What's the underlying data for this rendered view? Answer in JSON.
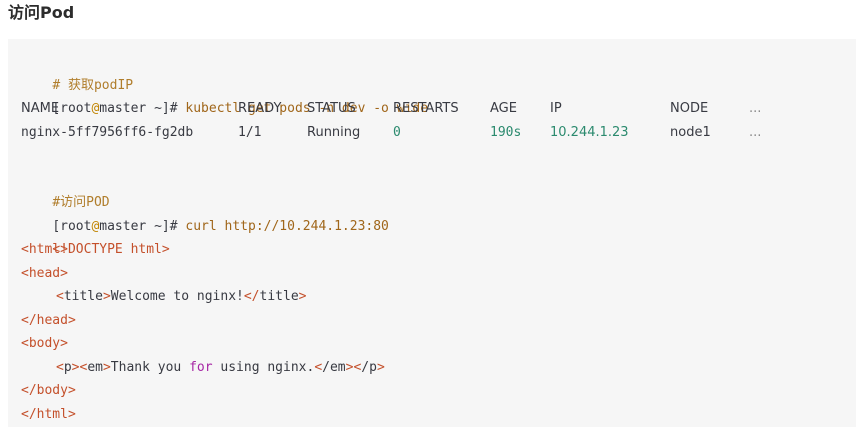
{
  "heading": "访问Pod",
  "code": {
    "comment1": "# 获取podIP",
    "prompt": {
      "open": "[",
      "user": "root",
      "at": "@",
      "host": "master",
      "rest": " ~]# "
    },
    "cmd1": "kubectl get pods -n dev -o wide",
    "table": {
      "headers": {
        "name": "NAME",
        "ready": "READY",
        "status": "STATUS",
        "restarts": "RESTARTS",
        "age": "AGE",
        "ip": "IP",
        "node": "NODE",
        "more": "..."
      },
      "row": {
        "name": "nginx-5ff7956ff6-fg2db",
        "ready": "1/1",
        "status": "Running",
        "restarts": "0",
        "age": "190s",
        "ip": "10.244.1.23",
        "node": "node1",
        "more": "..."
      }
    },
    "comment2": "#访问POD",
    "cmd2": "curl http://10.244.1.23:80",
    "html": {
      "doctype": "<!DOCTYPE html>",
      "html_open": "html",
      "head_open": "head",
      "title_tag": "title",
      "title_text": "Welcome to nginx!",
      "head_close": "/head",
      "body_open": "body",
      "p_tag": "p",
      "em_tag": "em",
      "thank_pre": "Thank you ",
      "thank_kw": "for",
      "thank_post": " using nginx.",
      "em_close": "/em",
      "p_close": "/p",
      "body_close": "/body",
      "html_close": "/html"
    }
  }
}
